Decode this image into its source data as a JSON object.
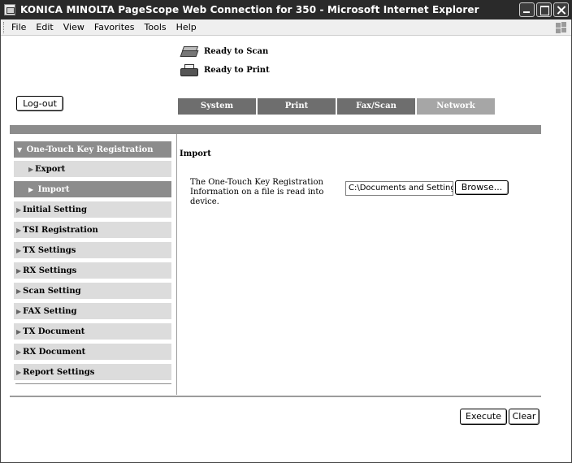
{
  "window": {
    "title": "KONICA MINOLTA PageScope Web Connection for 350 - Microsoft Internet Explorer"
  },
  "menubar": {
    "items": [
      "File",
      "Edit",
      "View",
      "Favorites",
      "Tools",
      "Help"
    ]
  },
  "status": {
    "scan": "Ready to Scan",
    "print": "Ready to Print"
  },
  "logout_label": "Log-out",
  "tabs": [
    "System",
    "Print",
    "Fax/Scan",
    "Network"
  ],
  "nav": {
    "header": "One-Touch Key Registration",
    "subitems": [
      "Export",
      "Import"
    ],
    "items": [
      "Initial Setting",
      "TSI Registration",
      "TX Settings",
      "RX Settings",
      "Scan Setting",
      "FAX Setting",
      "TX Document",
      "RX Document",
      "Report Settings"
    ]
  },
  "content": {
    "title": "Import",
    "description": "The One-Touch Key Registration Information on a file is read into device.",
    "file_path": "C:\\Documents and Settings",
    "browse_label": "Browse..."
  },
  "actions": {
    "execute": "Execute",
    "clear": "Clear"
  },
  "icons": {
    "scan": "scanner-icon",
    "print": "printer-icon",
    "app": "ie-icon"
  }
}
